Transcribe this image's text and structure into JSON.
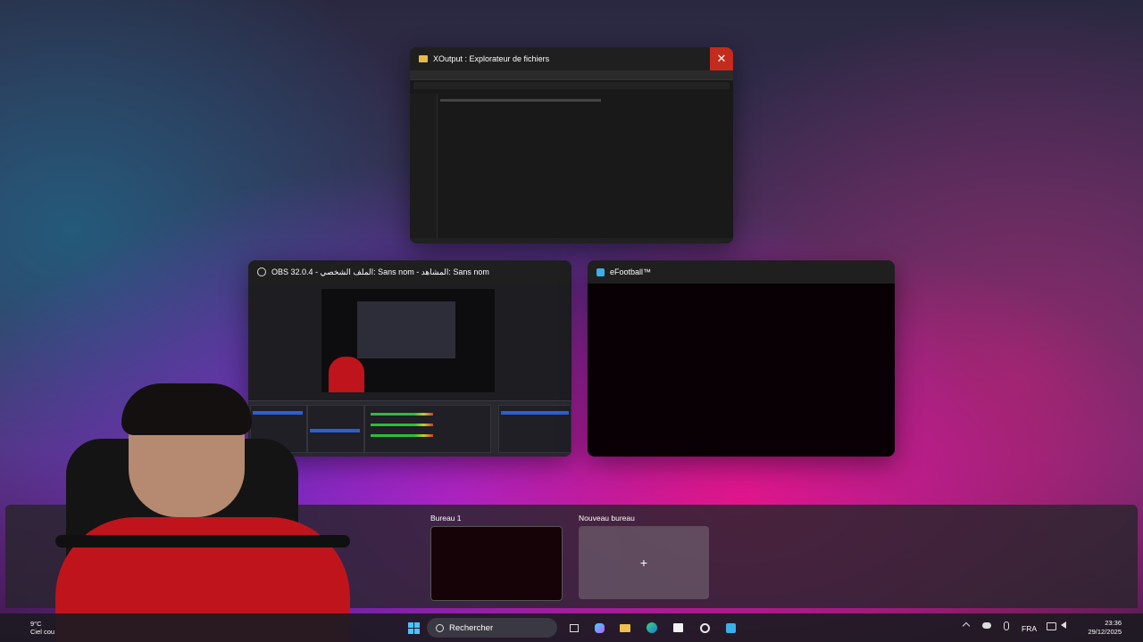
{
  "windows": {
    "explorer": {
      "title": "XOutput : Explorateur de fichiers",
      "close_glyph": "✕",
      "icon": "folder-icon"
    },
    "obs": {
      "title": "OBS 32.0.4 - الملف الشخصي: Sans nom - المشاهد: Sans nom",
      "icon": "obs-icon"
    },
    "efootball": {
      "title": "eFootball™",
      "icon": "efootball-icon"
    }
  },
  "desktops": [
    {
      "label": "Bureau 1"
    },
    {
      "label": "Nouveau bureau",
      "add_glyph": "+"
    }
  ],
  "taskbar": {
    "weather_temp": "9°C",
    "weather_desc": "Ciel cou",
    "search_label": "Rechercher",
    "language": "FRA",
    "time": "23:36",
    "date": "29/12/2025"
  },
  "colors": {
    "close_red": "#c42b1c",
    "accent_blue": "#0078d4"
  }
}
